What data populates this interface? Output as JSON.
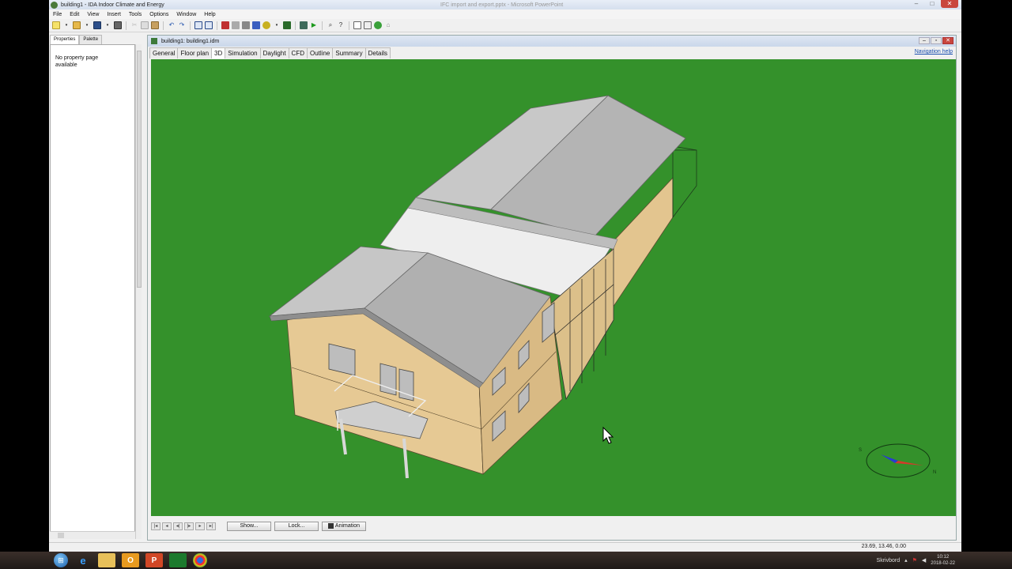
{
  "window": {
    "title": "building1 - IDA Indoor Climate and Energy",
    "background_title": "IFC import and export.pptx - Microsoft PowerPoint"
  },
  "menu": [
    "File",
    "Edit",
    "View",
    "Insert",
    "Tools",
    "Options",
    "Window",
    "Help"
  ],
  "toolbar": {
    "icons": [
      "new-icon",
      "open-icon",
      "save-icon",
      "print-icon",
      "cut-icon",
      "copy-icon",
      "paste-icon",
      "undo-icon",
      "redo-icon",
      "layout-icon",
      "split-icon",
      "building-icon",
      "zone-icon",
      "wall-icon",
      "object-icon",
      "system-icon",
      "plant-icon",
      "run-icon",
      "start-simulation-icon",
      "zoom-icon",
      "help-icon",
      "report-icon",
      "table-icon",
      "plant-green-icon",
      "house-icon"
    ]
  },
  "left_panel": {
    "tabs": [
      "Properties",
      "Palette"
    ],
    "active_tab": "Properties",
    "message": "No property page available"
  },
  "document": {
    "title": "building1: building1.idm",
    "tabs": [
      "General",
      "Floor plan",
      "3D",
      "Simulation",
      "Daylight",
      "CFD",
      "Outline",
      "Summary",
      "Details"
    ],
    "active_tab": "3D",
    "nav_help": "Navigation help",
    "viewport_bg": "#34912b",
    "compass": {
      "south_label": "S",
      "north_label": "N"
    }
  },
  "bottom_bar": {
    "show_label": "Show...",
    "lock_label": "Lock...",
    "animation_label": "Animation"
  },
  "status": {
    "coords": "23.69, 13.46, 0.00"
  },
  "taskbar": {
    "tray_label": "Skrivbord",
    "time": "10:12",
    "date": "2018-02-22"
  }
}
